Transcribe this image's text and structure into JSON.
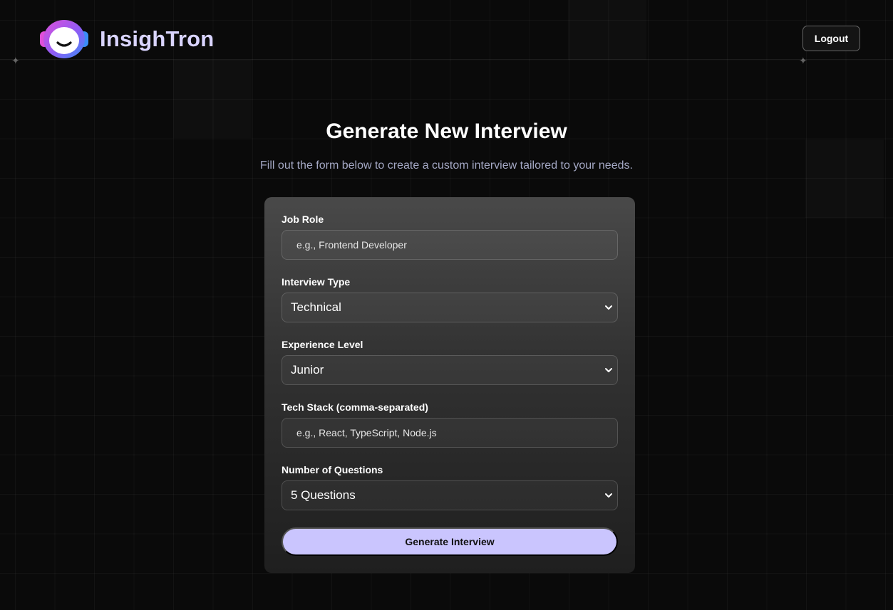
{
  "header": {
    "brand_name": "InsighTron",
    "logout_label": "Logout"
  },
  "main": {
    "title": "Generate New Interview",
    "subtitle": "Fill out the form below to create a custom interview tailored to your needs."
  },
  "form": {
    "job_role": {
      "label": "Job Role",
      "placeholder": "e.g., Frontend Developer"
    },
    "interview_type": {
      "label": "Interview Type",
      "value": "Technical"
    },
    "experience_level": {
      "label": "Experience Level",
      "value": "Junior"
    },
    "tech_stack": {
      "label": "Tech Stack (comma-separated)",
      "placeholder": "e.g., React, TypeScript, Node.js"
    },
    "num_questions": {
      "label": "Number of Questions",
      "value": "5 Questions"
    },
    "submit_label": "Generate Interview"
  },
  "icons": {
    "logo": "smiling-face-logo-icon",
    "select_arrow": "chevron-down-icon"
  },
  "colors": {
    "brand_text": "#d9d4ff",
    "primary_button": "#cac5fe",
    "subtitle_text": "#a4a8c4",
    "background": "#0a0a0a"
  }
}
